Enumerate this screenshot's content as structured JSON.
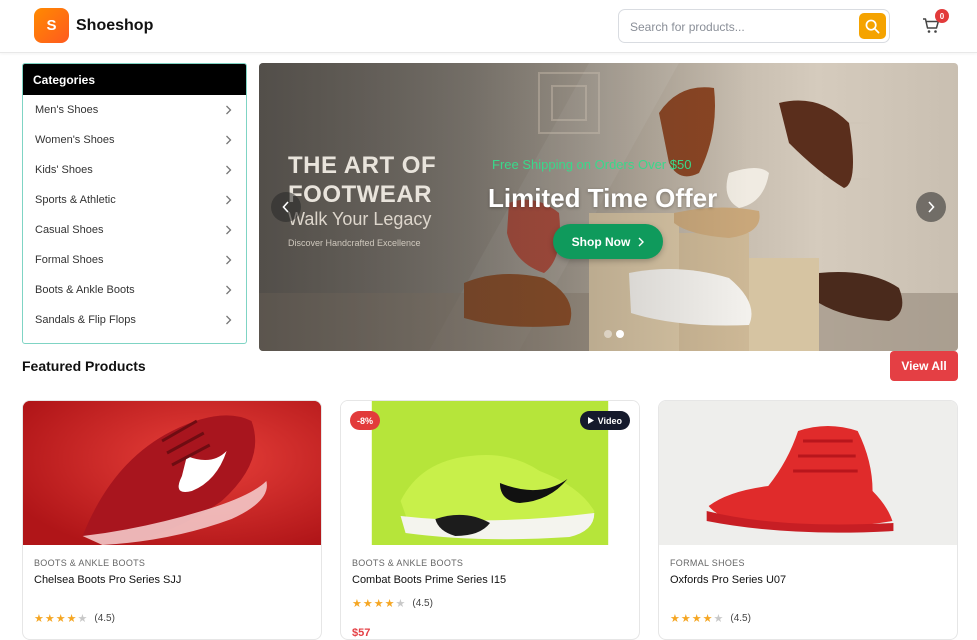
{
  "header": {
    "logo_letter": "S",
    "brand": "Shoeshop",
    "search_placeholder": "Search for products...",
    "cart_count": "0"
  },
  "categories": {
    "title": "Categories",
    "items": [
      {
        "label": "Men's Shoes"
      },
      {
        "label": "Women's Shoes"
      },
      {
        "label": "Kids' Shoes"
      },
      {
        "label": "Sports & Athletic"
      },
      {
        "label": "Casual Shoes"
      },
      {
        "label": "Formal Shoes"
      },
      {
        "label": "Boots & Ankle Boots"
      },
      {
        "label": "Sandals & Flip Flops"
      }
    ]
  },
  "hero": {
    "art_title": "THE ART OF FOOTWEAR",
    "art_subtitle": "Walk Your Legacy",
    "art_small": "Discover Handcrafted Excellence",
    "promo": "Free Shipping on Orders Over $50",
    "headline": "Limited Time Offer",
    "cta": "Shop Now",
    "slide_count": 2,
    "active_slide": 2
  },
  "featured": {
    "title": "Featured Products",
    "view_all": "View All",
    "products": [
      {
        "category": "BOOTS & ANKLE BOOTS",
        "name": "Chelsea Boots Pro Series SJJ",
        "rating": 4.5,
        "rating_text": "(4.5)",
        "image": "red-running-shoe"
      },
      {
        "category": "BOOTS & ANKLE BOOTS",
        "name": "Combat Boots Prime Series I15",
        "rating": 4.5,
        "rating_text": "(4.5)",
        "discount": "-8%",
        "video_label": "Video",
        "price_peek": "$57",
        "image": "lime-training-shoe"
      },
      {
        "category": "FORMAL SHOES",
        "name": "Oxfords Pro Series U07",
        "rating": 4.5,
        "rating_text": "(4.5)",
        "image": "red-high-top-sneaker"
      }
    ]
  },
  "colors": {
    "accent": "#f5a300",
    "brand_gradient_start": "#ff8a00",
    "danger": "#e43f44",
    "shop_now": "#0f9a5c",
    "promo_text": "#39d98a"
  }
}
